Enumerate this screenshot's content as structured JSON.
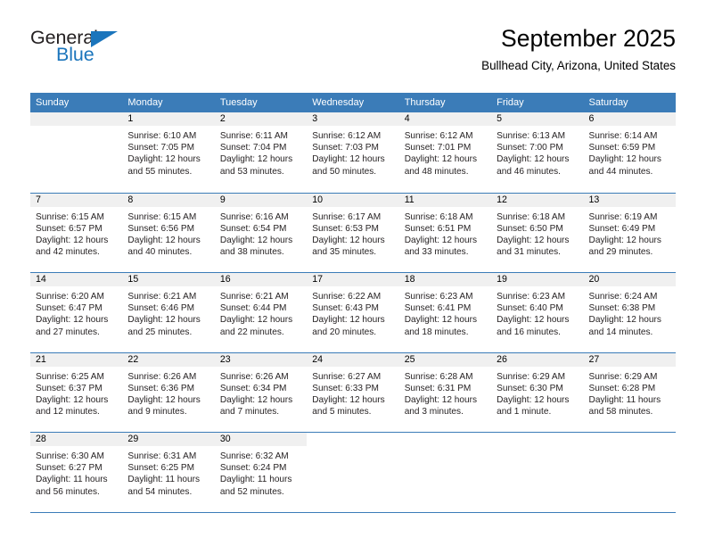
{
  "logo": {
    "word_top": "General",
    "word_bottom": "Blue",
    "triangle_color": "#1b75bc",
    "text_color": "#231f20"
  },
  "header": {
    "title": "September 2025",
    "subtitle": "Bullhead City, Arizona, United States"
  },
  "theme": {
    "header_blue": "#3b7cb8",
    "daynum_band": "#f0f0f0",
    "text": "#231f20"
  },
  "weekdays": [
    "Sunday",
    "Monday",
    "Tuesday",
    "Wednesday",
    "Thursday",
    "Friday",
    "Saturday"
  ],
  "weeks": [
    [
      {
        "day": "",
        "lines": []
      },
      {
        "day": "1",
        "lines": [
          "Sunrise: 6:10 AM",
          "Sunset: 7:05 PM",
          "Daylight: 12 hours",
          "and 55 minutes."
        ]
      },
      {
        "day": "2",
        "lines": [
          "Sunrise: 6:11 AM",
          "Sunset: 7:04 PM",
          "Daylight: 12 hours",
          "and 53 minutes."
        ]
      },
      {
        "day": "3",
        "lines": [
          "Sunrise: 6:12 AM",
          "Sunset: 7:03 PM",
          "Daylight: 12 hours",
          "and 50 minutes."
        ]
      },
      {
        "day": "4",
        "lines": [
          "Sunrise: 6:12 AM",
          "Sunset: 7:01 PM",
          "Daylight: 12 hours",
          "and 48 minutes."
        ]
      },
      {
        "day": "5",
        "lines": [
          "Sunrise: 6:13 AM",
          "Sunset: 7:00 PM",
          "Daylight: 12 hours",
          "and 46 minutes."
        ]
      },
      {
        "day": "6",
        "lines": [
          "Sunrise: 6:14 AM",
          "Sunset: 6:59 PM",
          "Daylight: 12 hours",
          "and 44 minutes."
        ]
      }
    ],
    [
      {
        "day": "7",
        "lines": [
          "Sunrise: 6:15 AM",
          "Sunset: 6:57 PM",
          "Daylight: 12 hours",
          "and 42 minutes."
        ]
      },
      {
        "day": "8",
        "lines": [
          "Sunrise: 6:15 AM",
          "Sunset: 6:56 PM",
          "Daylight: 12 hours",
          "and 40 minutes."
        ]
      },
      {
        "day": "9",
        "lines": [
          "Sunrise: 6:16 AM",
          "Sunset: 6:54 PM",
          "Daylight: 12 hours",
          "and 38 minutes."
        ]
      },
      {
        "day": "10",
        "lines": [
          "Sunrise: 6:17 AM",
          "Sunset: 6:53 PM",
          "Daylight: 12 hours",
          "and 35 minutes."
        ]
      },
      {
        "day": "11",
        "lines": [
          "Sunrise: 6:18 AM",
          "Sunset: 6:51 PM",
          "Daylight: 12 hours",
          "and 33 minutes."
        ]
      },
      {
        "day": "12",
        "lines": [
          "Sunrise: 6:18 AM",
          "Sunset: 6:50 PM",
          "Daylight: 12 hours",
          "and 31 minutes."
        ]
      },
      {
        "day": "13",
        "lines": [
          "Sunrise: 6:19 AM",
          "Sunset: 6:49 PM",
          "Daylight: 12 hours",
          "and 29 minutes."
        ]
      }
    ],
    [
      {
        "day": "14",
        "lines": [
          "Sunrise: 6:20 AM",
          "Sunset: 6:47 PM",
          "Daylight: 12 hours",
          "and 27 minutes."
        ]
      },
      {
        "day": "15",
        "lines": [
          "Sunrise: 6:21 AM",
          "Sunset: 6:46 PM",
          "Daylight: 12 hours",
          "and 25 minutes."
        ]
      },
      {
        "day": "16",
        "lines": [
          "Sunrise: 6:21 AM",
          "Sunset: 6:44 PM",
          "Daylight: 12 hours",
          "and 22 minutes."
        ]
      },
      {
        "day": "17",
        "lines": [
          "Sunrise: 6:22 AM",
          "Sunset: 6:43 PM",
          "Daylight: 12 hours",
          "and 20 minutes."
        ]
      },
      {
        "day": "18",
        "lines": [
          "Sunrise: 6:23 AM",
          "Sunset: 6:41 PM",
          "Daylight: 12 hours",
          "and 18 minutes."
        ]
      },
      {
        "day": "19",
        "lines": [
          "Sunrise: 6:23 AM",
          "Sunset: 6:40 PM",
          "Daylight: 12 hours",
          "and 16 minutes."
        ]
      },
      {
        "day": "20",
        "lines": [
          "Sunrise: 6:24 AM",
          "Sunset: 6:38 PM",
          "Daylight: 12 hours",
          "and 14 minutes."
        ]
      }
    ],
    [
      {
        "day": "21",
        "lines": [
          "Sunrise: 6:25 AM",
          "Sunset: 6:37 PM",
          "Daylight: 12 hours",
          "and 12 minutes."
        ]
      },
      {
        "day": "22",
        "lines": [
          "Sunrise: 6:26 AM",
          "Sunset: 6:36 PM",
          "Daylight: 12 hours",
          "and 9 minutes."
        ]
      },
      {
        "day": "23",
        "lines": [
          "Sunrise: 6:26 AM",
          "Sunset: 6:34 PM",
          "Daylight: 12 hours",
          "and 7 minutes."
        ]
      },
      {
        "day": "24",
        "lines": [
          "Sunrise: 6:27 AM",
          "Sunset: 6:33 PM",
          "Daylight: 12 hours",
          "and 5 minutes."
        ]
      },
      {
        "day": "25",
        "lines": [
          "Sunrise: 6:28 AM",
          "Sunset: 6:31 PM",
          "Daylight: 12 hours",
          "and 3 minutes."
        ]
      },
      {
        "day": "26",
        "lines": [
          "Sunrise: 6:29 AM",
          "Sunset: 6:30 PM",
          "Daylight: 12 hours",
          "and 1 minute."
        ]
      },
      {
        "day": "27",
        "lines": [
          "Sunrise: 6:29 AM",
          "Sunset: 6:28 PM",
          "Daylight: 11 hours",
          "and 58 minutes."
        ]
      }
    ],
    [
      {
        "day": "28",
        "lines": [
          "Sunrise: 6:30 AM",
          "Sunset: 6:27 PM",
          "Daylight: 11 hours",
          "and 56 minutes."
        ]
      },
      {
        "day": "29",
        "lines": [
          "Sunrise: 6:31 AM",
          "Sunset: 6:25 PM",
          "Daylight: 11 hours",
          "and 54 minutes."
        ]
      },
      {
        "day": "30",
        "lines": [
          "Sunrise: 6:32 AM",
          "Sunset: 6:24 PM",
          "Daylight: 11 hours",
          "and 52 minutes."
        ]
      },
      {
        "day": "",
        "lines": [],
        "blank": true
      },
      {
        "day": "",
        "lines": [],
        "blank": true
      },
      {
        "day": "",
        "lines": [],
        "blank": true
      },
      {
        "day": "",
        "lines": [],
        "blank": true
      }
    ]
  ]
}
